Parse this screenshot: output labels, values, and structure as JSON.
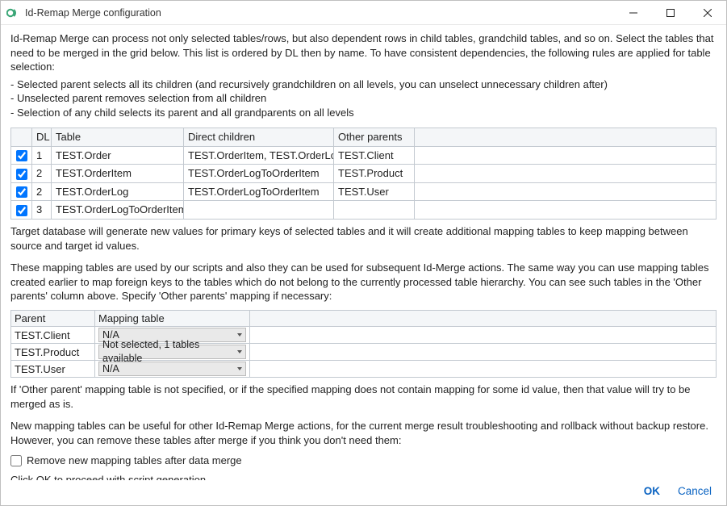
{
  "window": {
    "title": "Id-Remap Merge configuration"
  },
  "intro": {
    "p1": "Id-Remap Merge can process not only selected tables/rows, but also dependent rows in child tables, grandchild tables, and so on. Select the tables that need to be merged in the grid below. This list is ordered by DL then by name. To have consistent dependencies, the following rules are applied for table selection:",
    "rules": {
      "r1": "- Selected parent selects all its children (and recursively grandchildren on all levels, you can unselect unnecessary children after)",
      "r2": "- Unselected parent removes selection from all children",
      "r3": "- Selection of any child selects its parent and all grandparents on all levels"
    }
  },
  "grid": {
    "headers": {
      "check": "",
      "dl": "DL",
      "table": "Table",
      "children": "Direct children",
      "other": "Other parents"
    },
    "rows": [
      {
        "checked": true,
        "dl": "1",
        "table": "TEST.Order",
        "children": "TEST.OrderItem, TEST.OrderLog",
        "other": "TEST.Client"
      },
      {
        "checked": true,
        "dl": "2",
        "table": "TEST.OrderItem",
        "children": "TEST.OrderLogToOrderItem",
        "other": "TEST.Product"
      },
      {
        "checked": true,
        "dl": "2",
        "table": "TEST.OrderLog",
        "children": "TEST.OrderLogToOrderItem",
        "other": "TEST.User"
      },
      {
        "checked": true,
        "dl": "3",
        "table": "TEST.OrderLogToOrderItem",
        "children": "",
        "other": ""
      }
    ]
  },
  "mid": {
    "p1": "Target database will generate new values for primary keys of selected tables and it will create additional mapping tables to keep mapping between source and target id values.",
    "p2": "These mapping tables are used by our scripts and also they can be used for subsequent Id-Merge actions. The same way you can use mapping tables created earlier to map foreign keys to the tables which do not belong to the currently processed table hierarchy. You can see such tables in the 'Other parents' column above. Specify 'Other parents' mapping if necessary:"
  },
  "mapgrid": {
    "headers": {
      "parent": "Parent",
      "map": "Mapping table"
    },
    "rows": [
      {
        "parent": "TEST.Client",
        "map": "N/A"
      },
      {
        "parent": "TEST.Product",
        "map": "Not selected, 1 tables available"
      },
      {
        "parent": "TEST.User",
        "map": "N/A"
      }
    ]
  },
  "post": {
    "p1": "If 'Other parent' mapping table is not specified, or if the specified mapping does not contain mapping for some id value, then that value will try to be merged as is.",
    "p2": "New mapping tables can be useful for other Id-Remap Merge actions, for the current merge result troubleshooting and rollback without backup restore. However, you can remove these tables after merge if you think you don't need them:",
    "remove_label": "Remove new mapping tables after data merge",
    "remove_checked": false,
    "p3": "Click OK to proceed with script generation."
  },
  "footer": {
    "ok": "OK",
    "cancel": "Cancel"
  }
}
